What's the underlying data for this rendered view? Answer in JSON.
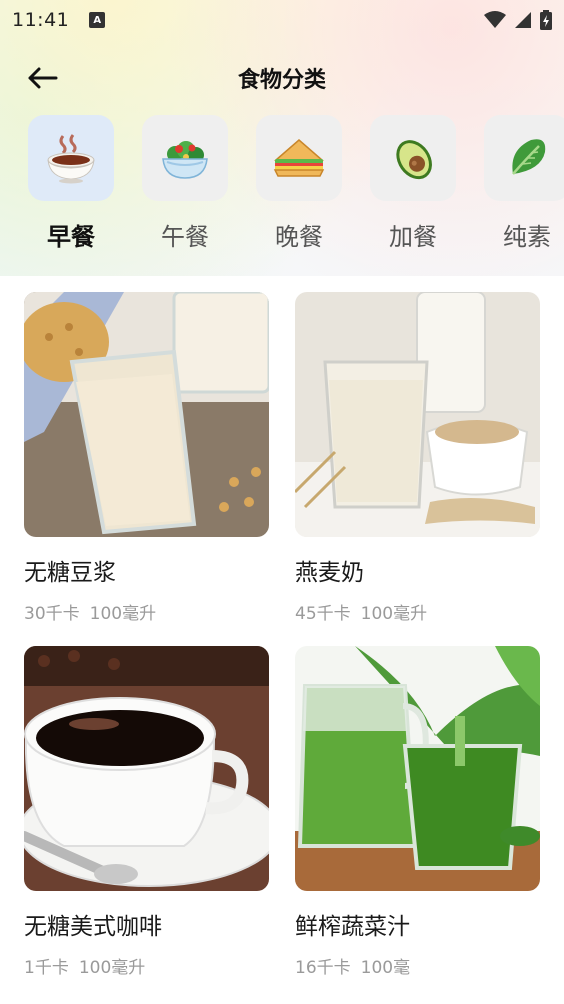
{
  "status_bar": {
    "time": "11:41",
    "notification_icon": "A"
  },
  "header": {
    "title": "食物分类",
    "back_icon": "arrow-left-icon"
  },
  "categories": [
    {
      "label": "早餐",
      "icon": "soup-bowl-icon",
      "active": true
    },
    {
      "label": "午餐",
      "icon": "salad-icon",
      "active": false
    },
    {
      "label": "晚餐",
      "icon": "sandwich-icon",
      "active": false
    },
    {
      "label": "加餐",
      "icon": "avocado-icon",
      "active": false
    },
    {
      "label": "纯素",
      "icon": "leafy-green-icon",
      "active": false
    }
  ],
  "foods": [
    {
      "name": "无糖豆浆",
      "calories": "30千卡",
      "portion": "100毫升"
    },
    {
      "name": "燕麦奶",
      "calories": "45千卡",
      "portion": "100毫升"
    },
    {
      "name": "无糖美式咖啡",
      "calories": "1千卡",
      "portion": "100毫升"
    },
    {
      "name": "鲜榨蔬菜汁",
      "calories": "16千卡",
      "portion": "100毫"
    }
  ],
  "colors": {
    "active_tile": "#dfeaf8",
    "inactive_tile": "#efefef",
    "meta_text": "#9a9a9a"
  }
}
